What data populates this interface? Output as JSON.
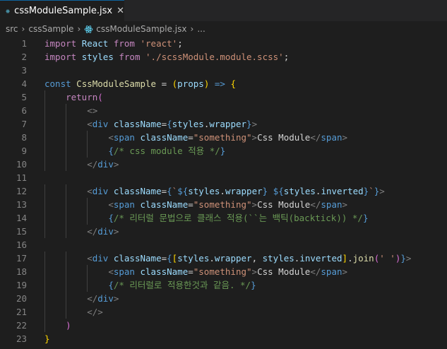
{
  "tab": {
    "filename": "cssModuleSample.jsx",
    "close_glyph": "✕",
    "icon": "react-icon"
  },
  "breadcrumb": {
    "items": [
      "src",
      "cssSample",
      "cssModuleSample.jsx",
      "..."
    ],
    "separator": "›"
  },
  "editor": {
    "line_numbers": [
      "1",
      "2",
      "3",
      "4",
      "5",
      "6",
      "7",
      "8",
      "9",
      "10",
      "11",
      "12",
      "13",
      "14",
      "15",
      "16",
      "17",
      "18",
      "19",
      "20",
      "21",
      "22",
      "23"
    ],
    "lines": [
      [
        [
          "k-kw",
          "import"
        ],
        [
          "k-punc",
          " "
        ],
        [
          "k-var",
          "React"
        ],
        [
          "k-punc",
          " "
        ],
        [
          "k-kw",
          "from"
        ],
        [
          "k-punc",
          " "
        ],
        [
          "k-str",
          "'react'"
        ],
        [
          "k-punc",
          ";"
        ]
      ],
      [
        [
          "k-kw",
          "import"
        ],
        [
          "k-punc",
          " "
        ],
        [
          "k-var",
          "styles"
        ],
        [
          "k-punc",
          " "
        ],
        [
          "k-kw",
          "from"
        ],
        [
          "k-punc",
          " "
        ],
        [
          "k-str",
          "'./scssModule.module.scss'"
        ],
        [
          "k-punc",
          ";"
        ]
      ],
      [],
      [
        [
          "k-blue",
          "const"
        ],
        [
          "k-punc",
          " "
        ],
        [
          "k-fn",
          "CssModuleSample"
        ],
        [
          "k-punc",
          " = "
        ],
        [
          "k-yellow",
          "("
        ],
        [
          "k-var",
          "props"
        ],
        [
          "k-yellow",
          ")"
        ],
        [
          "k-punc",
          " "
        ],
        [
          "k-blue",
          "=>"
        ],
        [
          "k-punc",
          " "
        ],
        [
          "k-yellow",
          "{"
        ]
      ],
      [
        [
          "k-punc",
          "    "
        ],
        [
          "k-kw",
          "return"
        ],
        [
          "k-purple",
          "("
        ]
      ],
      [
        [
          "k-punc",
          "        "
        ],
        [
          "k-ang",
          "<>"
        ]
      ],
      [
        [
          "k-punc",
          "        "
        ],
        [
          "k-ang",
          "<"
        ],
        [
          "k-tag",
          "div"
        ],
        [
          "k-punc",
          " "
        ],
        [
          "k-attr",
          "className"
        ],
        [
          "k-punc",
          "="
        ],
        [
          "k-blue",
          "{"
        ],
        [
          "k-var",
          "styles"
        ],
        [
          "k-punc",
          "."
        ],
        [
          "k-var",
          "wrapper"
        ],
        [
          "k-blue",
          "}"
        ],
        [
          "k-ang",
          ">"
        ]
      ],
      [
        [
          "k-punc",
          "            "
        ],
        [
          "k-ang",
          "<"
        ],
        [
          "k-tag",
          "span"
        ],
        [
          "k-punc",
          " "
        ],
        [
          "k-attr",
          "className"
        ],
        [
          "k-punc",
          "="
        ],
        [
          "k-str",
          "\"something\""
        ],
        [
          "k-ang",
          ">"
        ],
        [
          "k-punc",
          "Css Module"
        ],
        [
          "k-ang",
          "</"
        ],
        [
          "k-tag",
          "span"
        ],
        [
          "k-ang",
          ">"
        ]
      ],
      [
        [
          "k-punc",
          "            "
        ],
        [
          "k-blue",
          "{"
        ],
        [
          "k-com",
          "/* css module 적용 */"
        ],
        [
          "k-blue",
          "}"
        ]
      ],
      [
        [
          "k-punc",
          "        "
        ],
        [
          "k-ang",
          "</"
        ],
        [
          "k-tag",
          "div"
        ],
        [
          "k-ang",
          ">"
        ]
      ],
      [],
      [
        [
          "k-punc",
          "        "
        ],
        [
          "k-ang",
          "<"
        ],
        [
          "k-tag",
          "div"
        ],
        [
          "k-punc",
          " "
        ],
        [
          "k-attr",
          "className"
        ],
        [
          "k-punc",
          "="
        ],
        [
          "k-blue",
          "{"
        ],
        [
          "k-str",
          "`"
        ],
        [
          "k-blue",
          "${"
        ],
        [
          "k-var",
          "styles"
        ],
        [
          "k-punc",
          "."
        ],
        [
          "k-var",
          "wrapper"
        ],
        [
          "k-blue",
          "}"
        ],
        [
          "k-str",
          " "
        ],
        [
          "k-blue",
          "${"
        ],
        [
          "k-var",
          "styles"
        ],
        [
          "k-punc",
          "."
        ],
        [
          "k-var",
          "inverted"
        ],
        [
          "k-blue",
          "}"
        ],
        [
          "k-str",
          "`"
        ],
        [
          "k-blue",
          "}"
        ],
        [
          "k-ang",
          ">"
        ]
      ],
      [
        [
          "k-punc",
          "            "
        ],
        [
          "k-ang",
          "<"
        ],
        [
          "k-tag",
          "span"
        ],
        [
          "k-punc",
          " "
        ],
        [
          "k-attr",
          "className"
        ],
        [
          "k-punc",
          "="
        ],
        [
          "k-str",
          "\"something\""
        ],
        [
          "k-ang",
          ">"
        ],
        [
          "k-punc",
          "Css Module"
        ],
        [
          "k-ang",
          "</"
        ],
        [
          "k-tag",
          "span"
        ],
        [
          "k-ang",
          ">"
        ]
      ],
      [
        [
          "k-punc",
          "            "
        ],
        [
          "k-blue",
          "{"
        ],
        [
          "k-com",
          "/* 리터럴 문법으로 클래스 적용(``는 백틱(backtick)) */"
        ],
        [
          "k-blue",
          "}"
        ]
      ],
      [
        [
          "k-punc",
          "        "
        ],
        [
          "k-ang",
          "</"
        ],
        [
          "k-tag",
          "div"
        ],
        [
          "k-ang",
          ">"
        ]
      ],
      [],
      [
        [
          "k-punc",
          "        "
        ],
        [
          "k-ang",
          "<"
        ],
        [
          "k-tag",
          "div"
        ],
        [
          "k-punc",
          " "
        ],
        [
          "k-attr",
          "className"
        ],
        [
          "k-punc",
          "="
        ],
        [
          "k-blue",
          "{"
        ],
        [
          "k-yellow",
          "["
        ],
        [
          "k-var",
          "styles"
        ],
        [
          "k-punc",
          "."
        ],
        [
          "k-var",
          "wrapper"
        ],
        [
          "k-punc",
          ", "
        ],
        [
          "k-var",
          "styles"
        ],
        [
          "k-punc",
          "."
        ],
        [
          "k-var",
          "inverted"
        ],
        [
          "k-yellow",
          "]"
        ],
        [
          "k-punc",
          "."
        ],
        [
          "k-fn",
          "join"
        ],
        [
          "k-purple",
          "("
        ],
        [
          "k-str",
          "' '"
        ],
        [
          "k-purple",
          ")"
        ],
        [
          "k-blue",
          "}"
        ],
        [
          "k-ang",
          ">"
        ]
      ],
      [
        [
          "k-punc",
          "            "
        ],
        [
          "k-ang",
          "<"
        ],
        [
          "k-tag",
          "span"
        ],
        [
          "k-punc",
          " "
        ],
        [
          "k-attr",
          "className"
        ],
        [
          "k-punc",
          "="
        ],
        [
          "k-str",
          "\"something\""
        ],
        [
          "k-ang",
          ">"
        ],
        [
          "k-punc",
          "Css Module"
        ],
        [
          "k-ang",
          "</"
        ],
        [
          "k-tag",
          "span"
        ],
        [
          "k-ang",
          ">"
        ]
      ],
      [
        [
          "k-punc",
          "            "
        ],
        [
          "k-blue",
          "{"
        ],
        [
          "k-com",
          "/* 리터럴로 적용한것과 같음. */"
        ],
        [
          "k-blue",
          "}"
        ]
      ],
      [
        [
          "k-punc",
          "        "
        ],
        [
          "k-ang",
          "</"
        ],
        [
          "k-tag",
          "div"
        ],
        [
          "k-ang",
          ">"
        ]
      ],
      [
        [
          "k-punc",
          "        "
        ],
        [
          "k-ang",
          "</>"
        ]
      ],
      [
        [
          "k-punc",
          "    "
        ],
        [
          "k-purple",
          ")"
        ]
      ],
      [
        [
          "k-yellow",
          "}"
        ]
      ]
    ]
  }
}
